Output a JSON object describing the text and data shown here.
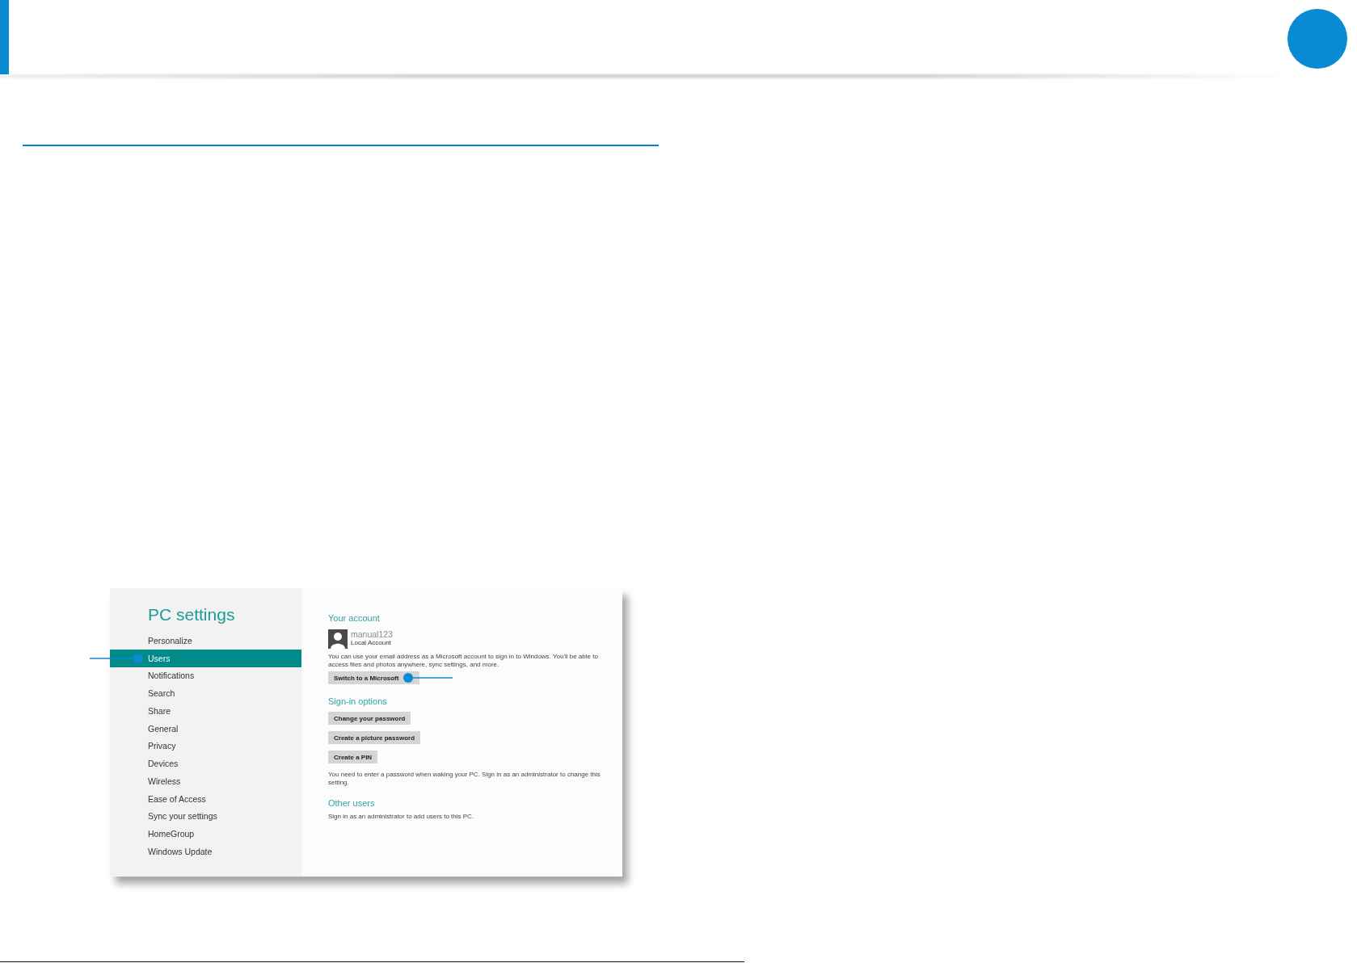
{
  "settings_window": {
    "title": "PC settings",
    "sidebar": {
      "items": [
        {
          "label": "Personalize",
          "selected": false
        },
        {
          "label": "Users",
          "selected": true
        },
        {
          "label": "Notifications",
          "selected": false
        },
        {
          "label": "Search",
          "selected": false
        },
        {
          "label": "Share",
          "selected": false
        },
        {
          "label": "General",
          "selected": false
        },
        {
          "label": "Privacy",
          "selected": false
        },
        {
          "label": "Devices",
          "selected": false
        },
        {
          "label": "Wireless",
          "selected": false
        },
        {
          "label": "Ease of Access",
          "selected": false
        },
        {
          "label": "Sync your settings",
          "selected": false
        },
        {
          "label": "HomeGroup",
          "selected": false
        },
        {
          "label": "Windows Update",
          "selected": false
        }
      ]
    },
    "account": {
      "heading": "Your account",
      "user_name": "manual123",
      "account_type": "Local Account",
      "description": "You can use your email address as a Microsoft account to sign in to Windows. You'll be able to access files and photos anywhere, sync settings, and more.",
      "button": "Switch to a Microsoft"
    },
    "sign_in_options": {
      "heading": "Sign-in options",
      "buttons": [
        "Change your password",
        "Create a picture password",
        "Create a PIN"
      ],
      "note": "You need to enter a password when waking your PC. Sign in as an administrator to change this setting."
    },
    "other_users": {
      "heading": "Other users",
      "note": "Sign in as an administrator to add users to this PC."
    }
  }
}
